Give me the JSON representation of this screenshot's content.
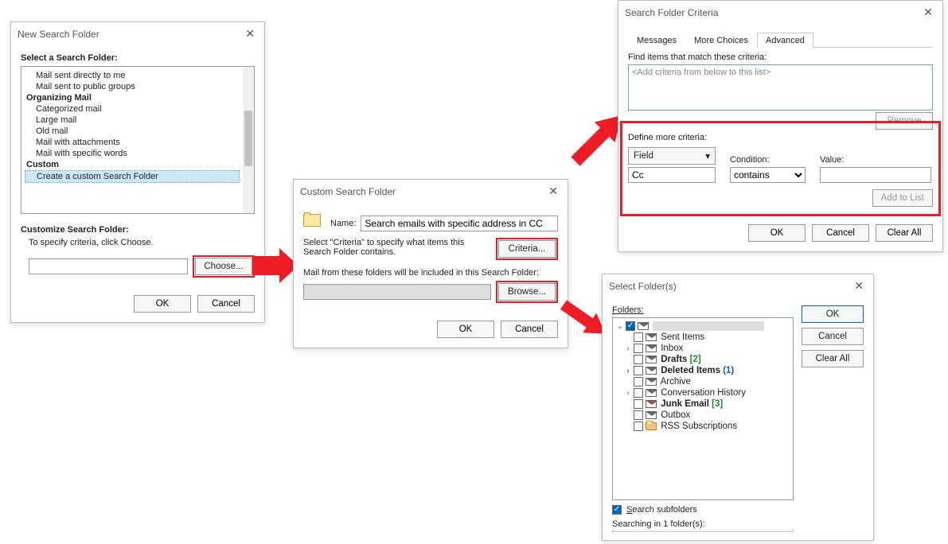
{
  "newSearchFolder": {
    "title": "New Search Folder",
    "selectLabel": "Select a Search Folder:",
    "items": [
      {
        "type": "item",
        "label": "Mail sent directly to me"
      },
      {
        "type": "item",
        "label": "Mail sent to public groups"
      },
      {
        "type": "header",
        "label": "Organizing Mail"
      },
      {
        "type": "item",
        "label": "Categorized mail"
      },
      {
        "type": "item",
        "label": "Large mail"
      },
      {
        "type": "item",
        "label": "Old mail"
      },
      {
        "type": "item",
        "label": "Mail with attachments"
      },
      {
        "type": "item",
        "label": "Mail with specific words"
      },
      {
        "type": "header",
        "label": "Custom"
      },
      {
        "type": "item",
        "label": "Create a custom Search Folder",
        "selected": true
      }
    ],
    "customizeLabel": "Customize Search Folder:",
    "specifyLabel": "To specify criteria, click Choose.",
    "chooseBtn": "Choose...",
    "ok": "OK",
    "cancel": "Cancel"
  },
  "customSearchFolder": {
    "title": "Custom Search Folder",
    "nameLabel": "Name:",
    "nameValue": "Search emails with specific address in CC",
    "criteriaDesc": "Select \"Criteria\" to specify what items this Search Folder contains.",
    "criteriaBtn": "Criteria...",
    "foldersDesc": "Mail from these folders will be included in this Search Folder:",
    "browseBtn": "Browse...",
    "ok": "OK",
    "cancel": "Cancel"
  },
  "criteriaDialog": {
    "title": "Search Folder Criteria",
    "tabs": [
      "Messages",
      "More Choices",
      "Advanced"
    ],
    "activeTab": 2,
    "findLabel": "Find items that match these criteria:",
    "listPlaceholder": "<Add criteria from below to this list>",
    "removeBtn": "Remove",
    "defineLabel": "Define more criteria:",
    "fieldBtn": "Field",
    "conditionLabel": "Condition:",
    "valueLabel": "Value:",
    "fieldValue": "Cc",
    "conditionValue": "contains",
    "valueValue": "",
    "addBtn": "Add to List",
    "ok": "OK",
    "cancel": "Cancel",
    "clearAll": "Clear All"
  },
  "selectFolders": {
    "title": "Select Folder(s)",
    "foldersLabel": "Folders:",
    "tree": [
      {
        "indent": 0,
        "exp": "v",
        "checked": true,
        "icon": "mail",
        "label": "",
        "redact": true,
        "bold": false
      },
      {
        "indent": 1,
        "exp": " ",
        "checked": false,
        "icon": "mail",
        "label": "Sent Items"
      },
      {
        "indent": 1,
        "exp": ">",
        "checked": false,
        "icon": "mail",
        "label": "Inbox"
      },
      {
        "indent": 1,
        "exp": " ",
        "checked": false,
        "icon": "mail",
        "label": "Drafts",
        "suffix": "[2]",
        "suffixColor": "#1e8a2c",
        "bold": true
      },
      {
        "indent": 1,
        "exp": ">",
        "checked": false,
        "icon": "mail",
        "label": "Deleted Items",
        "suffix": "(1)",
        "suffixColor": "#1856c4",
        "bold": true
      },
      {
        "indent": 1,
        "exp": " ",
        "checked": false,
        "icon": "mail",
        "label": "Archive"
      },
      {
        "indent": 1,
        "exp": ">",
        "checked": false,
        "icon": "mail",
        "label": "Conversation History"
      },
      {
        "indent": 1,
        "exp": " ",
        "checked": false,
        "icon": "junk",
        "label": "Junk Email",
        "suffix": "[3]",
        "suffixColor": "#1e8a2c",
        "bold": true
      },
      {
        "indent": 1,
        "exp": " ",
        "checked": false,
        "icon": "mail",
        "label": "Outbox"
      },
      {
        "indent": 1,
        "exp": " ",
        "checked": false,
        "icon": "rss",
        "label": "RSS Subscriptions"
      }
    ],
    "searchSubCheckLabel": "Search subfolders",
    "searchSubChecked": true,
    "searchingIn": "Searching in 1 folder(s):",
    "ok": "OK",
    "cancel": "Cancel",
    "clearAll": "Clear All"
  }
}
